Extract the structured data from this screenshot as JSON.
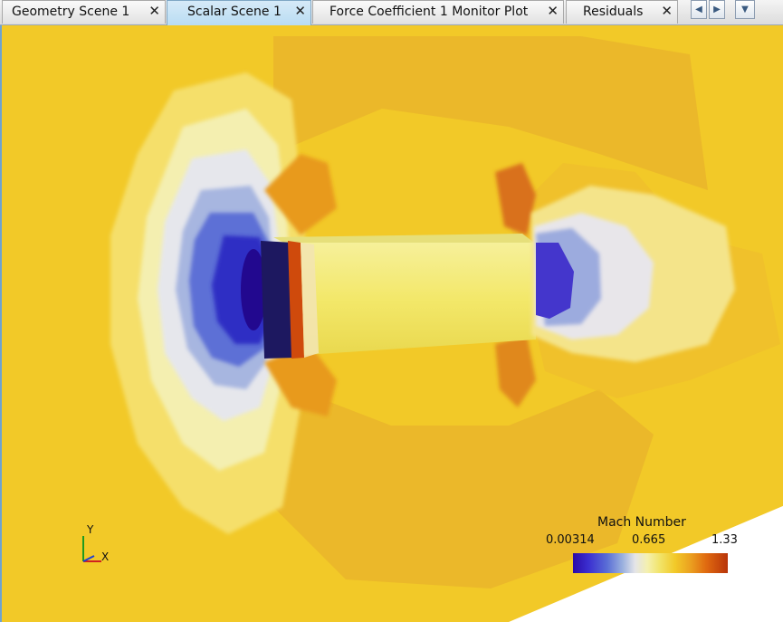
{
  "tabs": [
    {
      "label": "Geometry Scene 1",
      "active": false
    },
    {
      "label": "Scalar Scene 1",
      "active": true
    },
    {
      "label": "Force Coefficient 1 Monitor Plot",
      "active": false
    },
    {
      "label": "Residuals",
      "active": false
    }
  ],
  "tab_close_glyph": "✕",
  "nav": {
    "prev_icon": "◀",
    "next_icon": "▶",
    "menu_icon": "▼"
  },
  "legend": {
    "title": "Mach Number",
    "min_label": "0.00314",
    "mid_label": "0.665",
    "max_label": "1.33"
  },
  "triad": {
    "y_label": "Y",
    "x_label": "X"
  },
  "colors": {
    "background_field": "#f2c928",
    "stagnation": "#2a0aa8",
    "shock": "#d5560e"
  }
}
